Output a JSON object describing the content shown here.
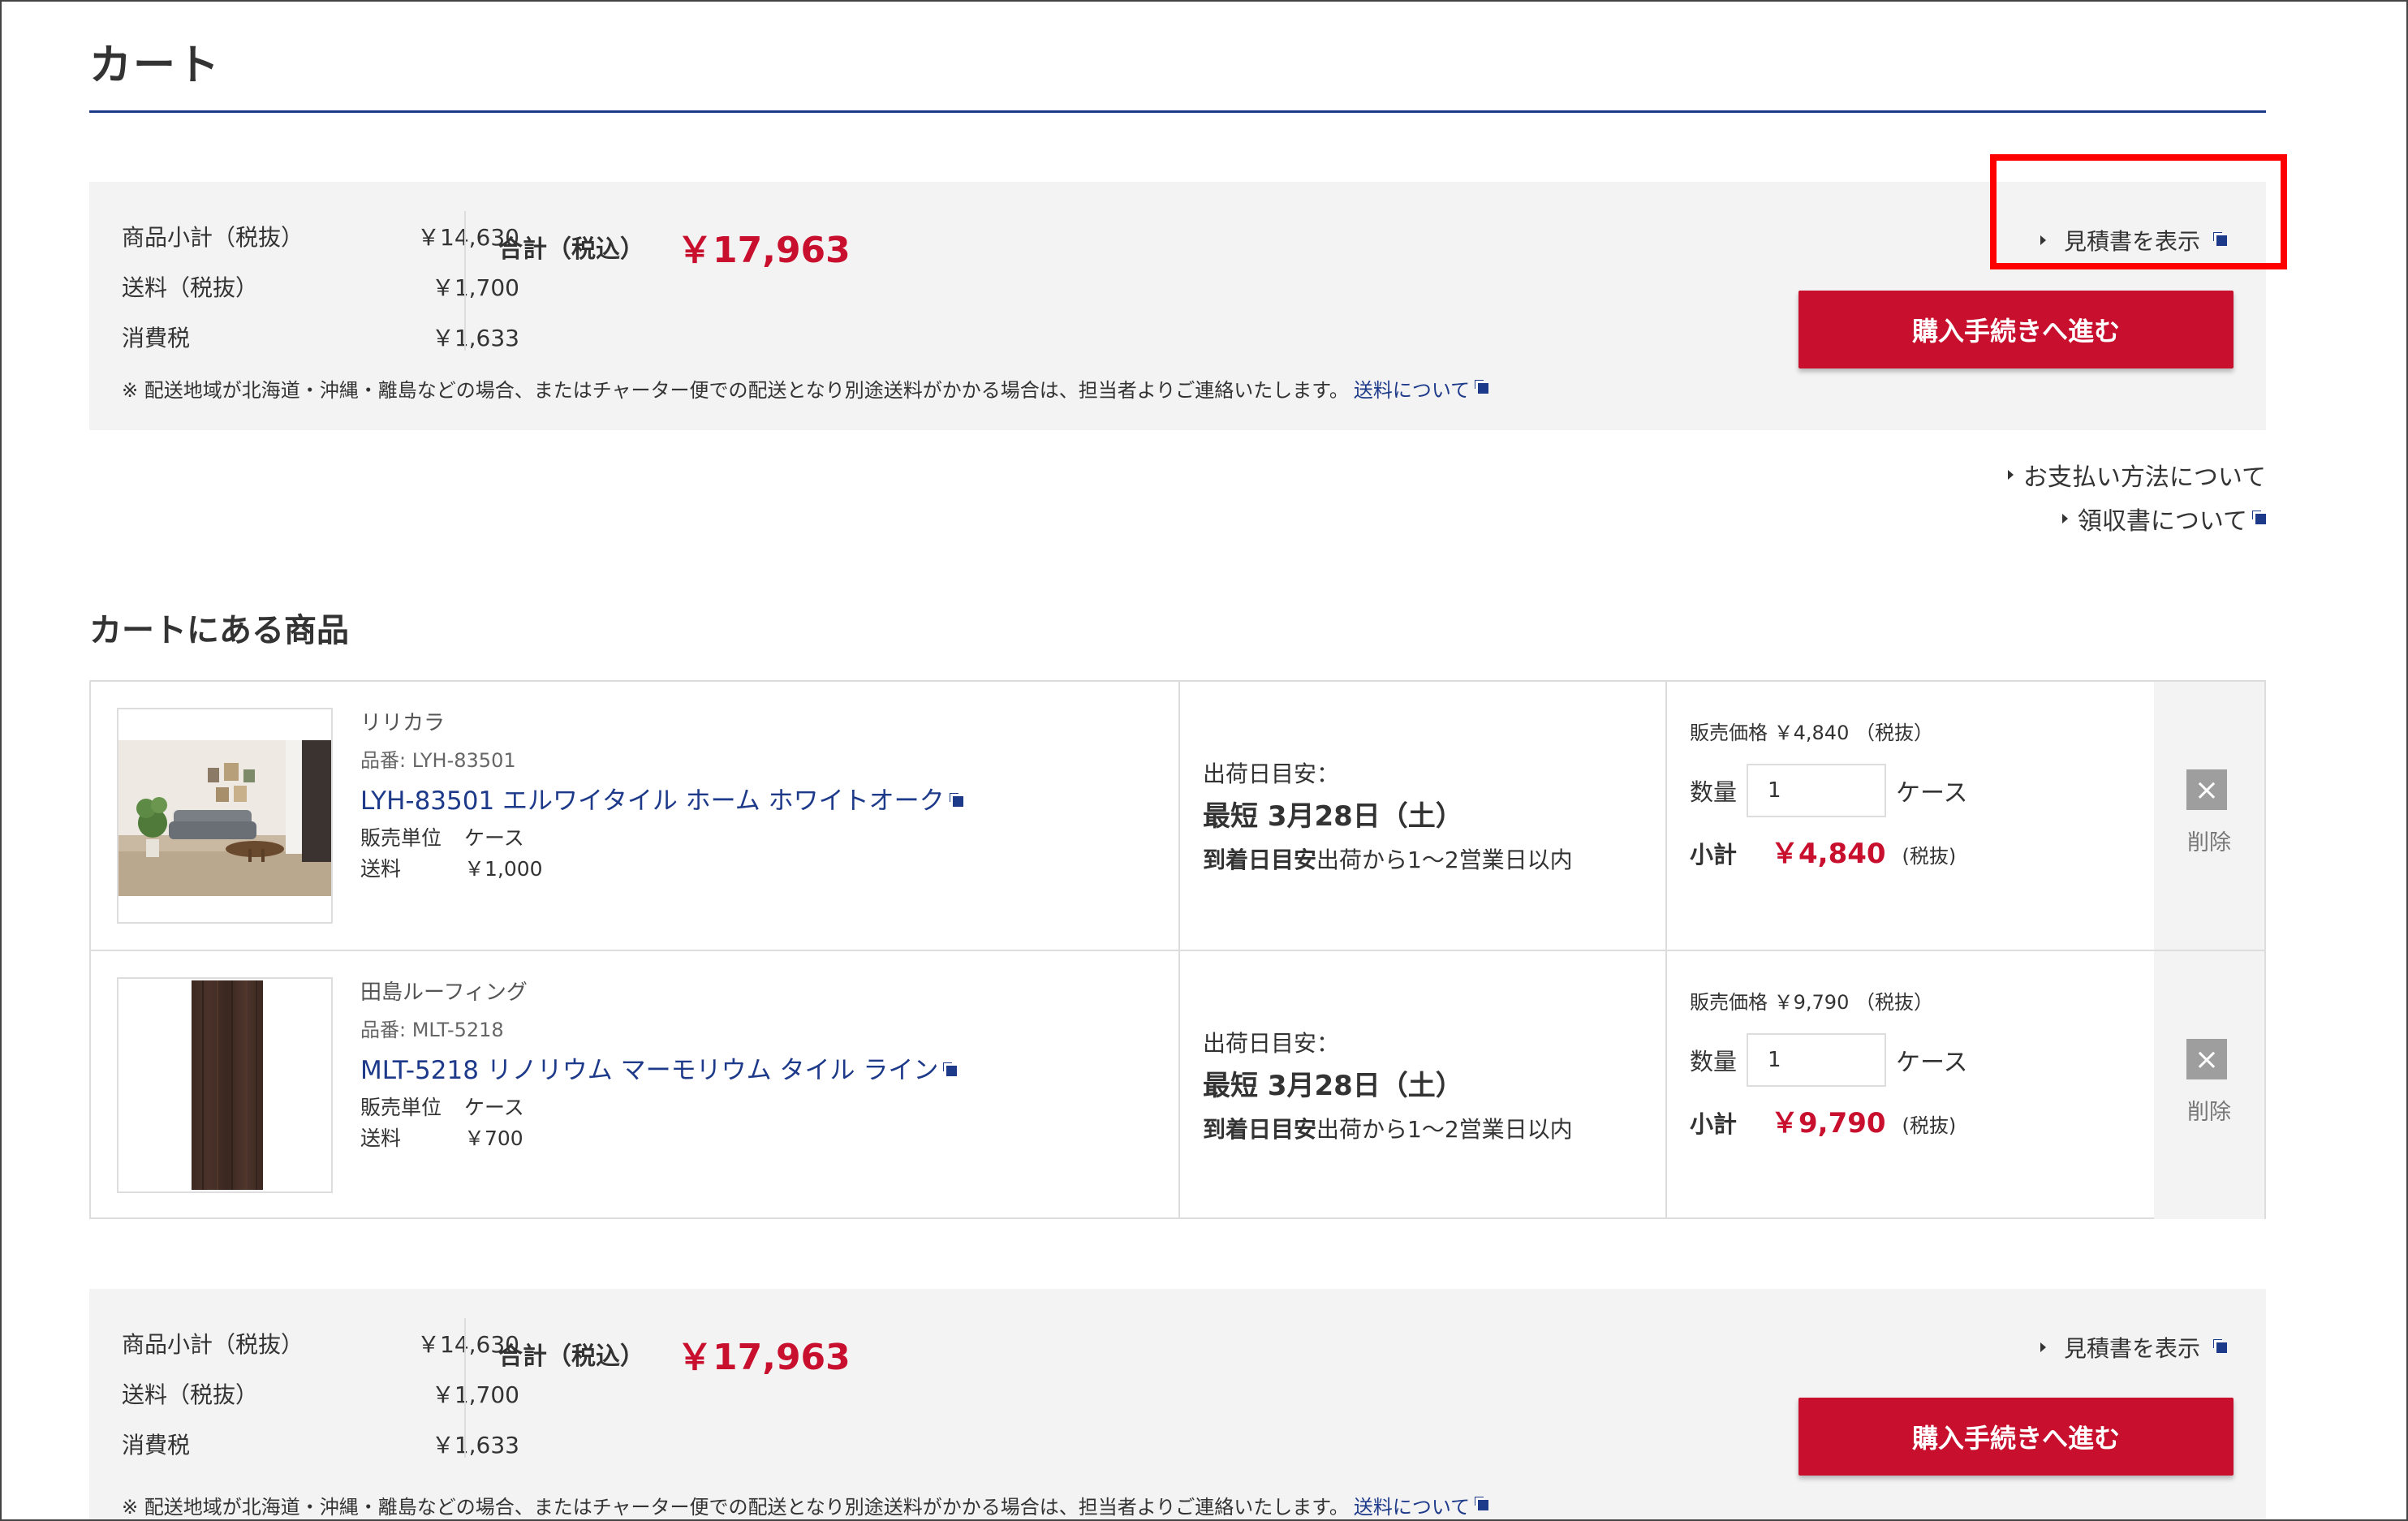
{
  "page": {
    "title": "カート"
  },
  "summary_top": {
    "rows": [
      {
        "label": "商品小計（税抜）",
        "value": "￥14,630"
      },
      {
        "label": "送料（税抜）",
        "value": "￥1,700"
      },
      {
        "label": "消費税",
        "value": "￥1,633"
      }
    ],
    "total_label": "合計（税込）",
    "total_value": "￥17,963",
    "note": "※ 配送地域が北海道・沖縄・離島などの場合、またはチャーター便での配送となり別途送料がかかる場合は、担当者よりご連絡いたします。",
    "note_link": "送料について",
    "quote_link": "見積書を表示",
    "buy_button": "購入手続きへ進む"
  },
  "links": {
    "payment": "お支払い方法について",
    "receipt": "領収書について"
  },
  "section_title": "カートにある商品",
  "items": [
    {
      "brand": "リリカラ",
      "part_no": "品番: LYH-83501",
      "name": "LYH-83501 エルワイタイル ホーム ホワイトオーク",
      "unit_label": "販売単位",
      "unit_value": "ケース",
      "ship_label": "送料",
      "ship_value": "￥1,000",
      "ship_est_label": "出荷日目安：",
      "ship_est_value": "最短 3月28日（土）",
      "arrival_label": "到着日目安",
      "arrival_value": "出荷から1〜2営業日以内",
      "price_text": "販売価格 ￥4,840 （税抜）",
      "qty_label": "数量",
      "qty_value": "1",
      "qty_unit": "ケース",
      "subtotal_label": "小計",
      "subtotal_value": "￥4,840",
      "subtotal_tax": "(税抜)",
      "delete_label": "削除"
    },
    {
      "brand": "田島ルーフィング",
      "part_no": "品番: MLT-5218",
      "name": "MLT-5218 リノリウム マーモリウム タイル ライン",
      "unit_label": "販売単位",
      "unit_value": "ケース",
      "ship_label": "送料",
      "ship_value": "￥700",
      "ship_est_label": "出荷日目安：",
      "ship_est_value": "最短 3月28日（土）",
      "arrival_label": "到着日目安",
      "arrival_value": "出荷から1〜2営業日以内",
      "price_text": "販売価格 ￥9,790 （税抜）",
      "qty_label": "数量",
      "qty_value": "1",
      "qty_unit": "ケース",
      "subtotal_label": "小計",
      "subtotal_value": "￥9,790",
      "subtotal_tax": "(税抜)",
      "delete_label": "削除"
    }
  ],
  "summary_bottom": {
    "rows": [
      {
        "label": "商品小計（税抜）",
        "value": "￥14,630"
      },
      {
        "label": "送料（税抜）",
        "value": "￥1,700"
      },
      {
        "label": "消費税",
        "value": "￥1,633"
      }
    ],
    "total_label": "合計（税込）",
    "total_value": "￥17,963",
    "note": "※ 配送地域が北海道・沖縄・離島などの場合、またはチャーター便での配送となり別途送料がかかる場合は、担当者よりご連絡いたします。",
    "note_link": "送料について",
    "quote_link": "見積書を表示",
    "buy_button": "購入手続きへ進む"
  },
  "colors": {
    "accent_red": "#c8102e",
    "link_blue": "#1d3a8a",
    "panel_gray": "#f3f3f3",
    "annotation_red": "#ff0000"
  },
  "icons": [
    "triangle-bullet-icon",
    "external-window-icon",
    "close-icon"
  ]
}
